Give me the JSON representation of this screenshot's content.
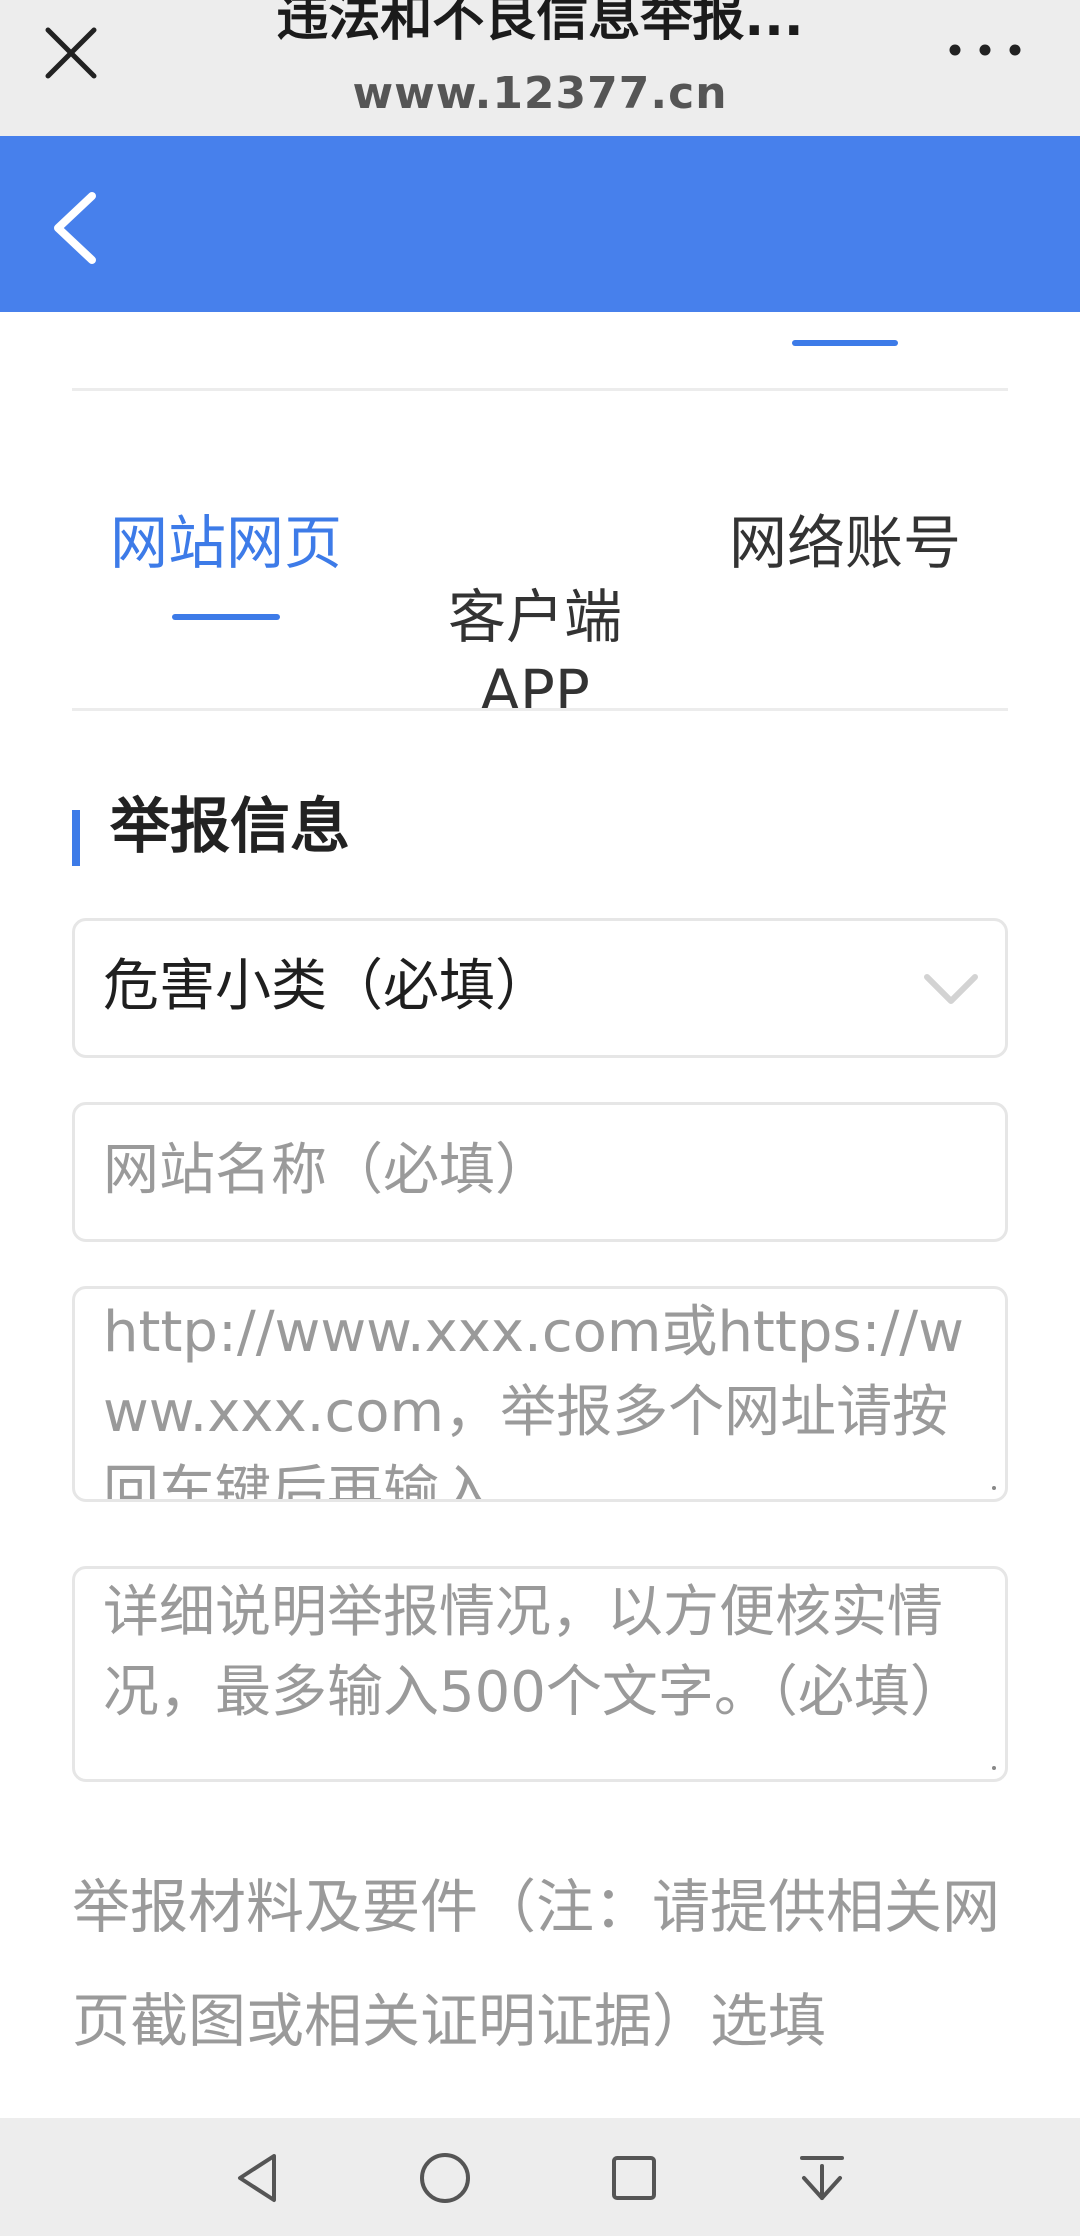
{
  "topbar": {
    "title": "违法和不良信息举报...",
    "url": "www.12377.cn"
  },
  "tabs": [
    {
      "label": "网站网页",
      "active": true
    },
    {
      "label": "客户端\nAPP",
      "active": false
    },
    {
      "label": "网络账号",
      "active": false
    }
  ],
  "section": {
    "title": "举报信息"
  },
  "form": {
    "category_select": "危害小类（必填）",
    "site_name_placeholder": "网站名称（必填）",
    "url_placeholder": "http://www.xxx.com或https://www.xxx.com，举报多个网址请按回车键后再输入",
    "detail_placeholder": "详细说明举报情况，以方便核实情况，最多输入500个文字。（必填）",
    "materials_label": "举报材料及要件（注：请提供相关网页截图或相关证明证据）选填"
  },
  "colors": {
    "accent": "#4780ec",
    "tab_active": "#3d7be8",
    "placeholder": "#9a9a9a"
  }
}
